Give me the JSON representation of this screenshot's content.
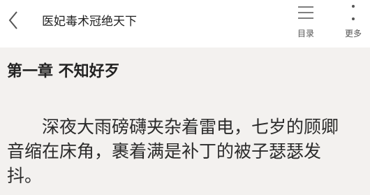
{
  "header": {
    "back_icon": "chevron-left-icon",
    "book_title": "医妃毒术冠绝天下",
    "toc": {
      "icon": "list-icon",
      "label": "目录"
    },
    "more": {
      "icon": "vertical-dots-icon",
      "label": "更多"
    }
  },
  "content": {
    "chapter_title": "第一章 不知好歹",
    "paragraph": "深夜大雨磅礴夹杂着雷电，七岁的顾卿音缩在床角，裹着满是补丁的被子瑟瑟发抖。"
  },
  "colors": {
    "header_bg": "#ffffff",
    "reader_bg": "#f3f1ef",
    "text": "#2b2b2b"
  }
}
